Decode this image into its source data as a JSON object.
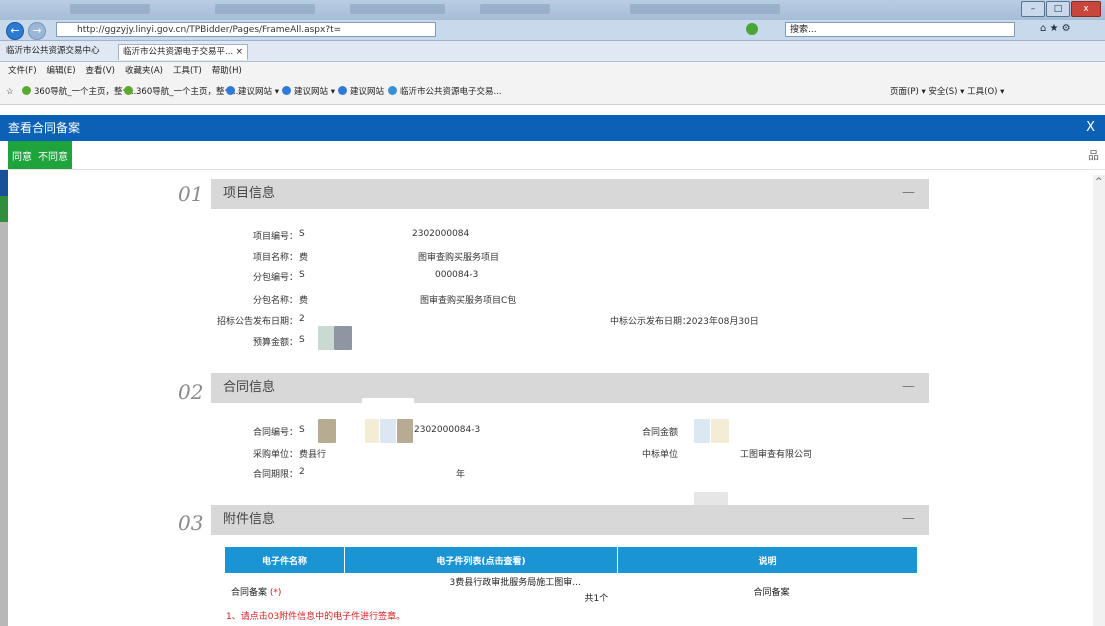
{
  "browser": {
    "address": "http://ggzyjy.linyi.gov.cn/TPBidder/Pages/FrameAll.aspx?t=",
    "search_placeholder": "搜索...",
    "tabs": [
      "临沂市公共资源交易中心",
      "临沂市公共资源电子交易平... ×"
    ],
    "menu": [
      "文件(F)",
      "编辑(E)",
      "查看(V)",
      "收藏夹(A)",
      "工具(T)",
      "帮助(H)"
    ],
    "favorites": [
      "360导航_一个主页，整个...",
      "360导航_一个主页，整个...",
      "建议网站 ▾",
      "建议网站 ▾",
      "建议网站",
      "临沂市公共资源电子交易..."
    ],
    "command_bar": "页面(P) ▾  安全(S) ▾  工具(O) ▾"
  },
  "dialog": {
    "title": "查看合同备案",
    "close": "X",
    "agree": "同意",
    "disagree": "不同意"
  },
  "sections": {
    "project": {
      "num": "01",
      "title": "项目信息",
      "collapse": "—",
      "fields": {
        "project_no_label": "项目编号：",
        "project_no_value": "S",
        "project_no_tail": "2302000084",
        "project_name_label": "项目名称：",
        "project_name_value": "费",
        "project_name_tail": "图审查购买服务项目",
        "package_no_label": "分包编号：",
        "package_no_value": "S",
        "package_no_tail": "000084-3",
        "package_name_label": "分包名称：",
        "package_name_value": "费",
        "package_name_tail": "图审查购买服务项目C包",
        "bid_date_label": "招标公告发布日期：",
        "bid_date_value": "2",
        "award_date_label": "中标公示发布日期：",
        "award_date_value": "2023年08月30日",
        "budget_label": "预算金额：",
        "budget_value": "S"
      }
    },
    "contract": {
      "num": "02",
      "title": "合同信息",
      "collapse": "—",
      "fields": {
        "contract_no_label": "合同编号：",
        "contract_no_value": "S",
        "contract_no_tail": "2302000084-3",
        "amount_label": "合同金额",
        "buyer_label": "采购单位：",
        "buyer_value": "费县行",
        "winner_label": "中标单位",
        "winner_value": "工图审查有限公司",
        "period_label": "合同期限：",
        "period_value": "2",
        "period_tail": "年"
      }
    },
    "attachments": {
      "num": "03",
      "title": "附件信息",
      "collapse": "—",
      "headers": [
        "电子件名称",
        "电子件列表(点击查看)",
        "说明"
      ],
      "rows": [
        {
          "name": "合同备案",
          "required": "(*)",
          "file": "3费县行政审批服务局施工图审...",
          "count": "共1个",
          "desc": "合同备案"
        }
      ],
      "notes": [
        "1、请点击03附件信息中的电子件进行签章。"
      ]
    }
  }
}
